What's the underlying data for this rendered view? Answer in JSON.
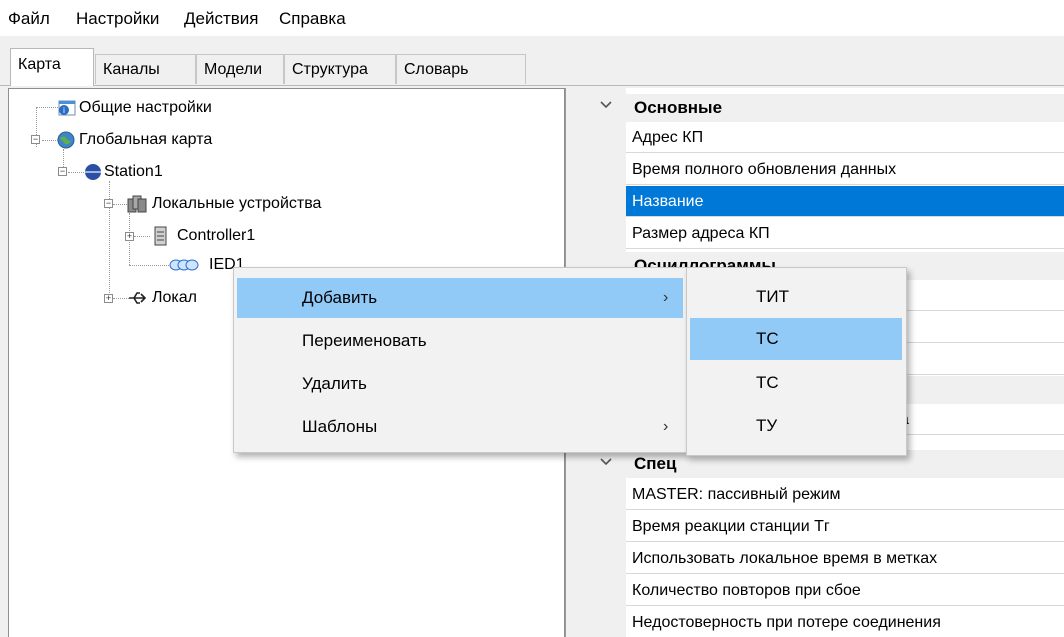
{
  "menubar": {
    "items": [
      "Файл",
      "Настройки",
      "Действия",
      "Справка"
    ]
  },
  "tabs": [
    "Карта",
    "Каналы",
    "Модели",
    "Структура",
    "Словарь"
  ],
  "active_tab": "Карта",
  "tree": {
    "general_settings": "Общие настройки",
    "global_map": "Глобальная карта",
    "station": "Station1",
    "local_devices": "Локальные устройства",
    "controller": "Controller1",
    "ied": "IED1",
    "local_interfaces": "Локал"
  },
  "properties": {
    "cat_main": "Основные",
    "rows_main": [
      "Адрес КП",
      "Время полного обновления данных",
      "Название",
      "Размер адреса КП"
    ],
    "selected_row": "Название",
    "cat_osc": "Осциллограммы",
    "osc_row_partial": "лограмм",
    "cat_hidden_row_partial": "а",
    "cat_spec": "Спец",
    "rows_spec": [
      "MASTER: пассивный режим",
      "Время реакции станции Тг",
      "Использовать локальное время в метках",
      "Количество повторов при сбое",
      "Недостоверность при потере соединения"
    ]
  },
  "context_menu": {
    "items": [
      {
        "label": "Добавить",
        "has_submenu": true,
        "highlighted": true
      },
      {
        "label": "Переименовать",
        "has_submenu": false,
        "highlighted": false
      },
      {
        "label": "Удалить",
        "has_submenu": false,
        "highlighted": false
      },
      {
        "label": "Шаблоны",
        "has_submenu": true,
        "highlighted": false
      }
    ],
    "arrow": "›"
  },
  "submenu": {
    "items": [
      {
        "label": "ТИТ",
        "highlighted": false
      },
      {
        "label": "ТС",
        "highlighted": true
      },
      {
        "label": "ТС",
        "highlighted": false
      },
      {
        "label": "ТУ",
        "highlighted": false
      }
    ]
  },
  "colors": {
    "selection": "#0078d7",
    "menu_highlight": "#91c9f7",
    "background": "#f0f0f0"
  }
}
